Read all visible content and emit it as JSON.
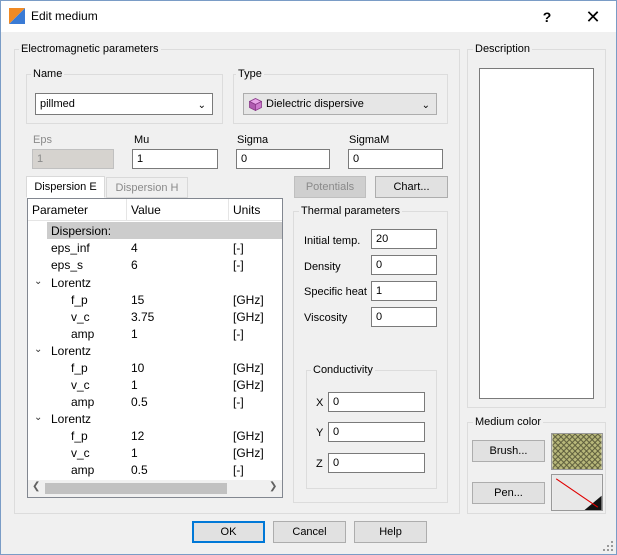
{
  "window": {
    "title": "Edit medium",
    "help_label": "?",
    "close_label": "✕",
    "app_icon": "app-icon"
  },
  "em_group": {
    "label": "Electromagnetic parameters"
  },
  "name": {
    "label": "Name",
    "value": "pillmed"
  },
  "type": {
    "label": "Type",
    "value": "Dielectric dispersive",
    "icon": "cube-icon"
  },
  "fields": {
    "eps": {
      "label": "Eps",
      "value": "1"
    },
    "mu": {
      "label": "Mu",
      "value": "1"
    },
    "sigma": {
      "label": "Sigma",
      "value": "0"
    },
    "sigmam": {
      "label": "SigmaM",
      "value": "0"
    }
  },
  "tabs": {
    "dispersion_e": "Dispersion E",
    "dispersion_h": "Dispersion H"
  },
  "buttons": {
    "potentials": "Potentials",
    "chart": "Chart...",
    "ok": "OK",
    "cancel": "Cancel",
    "help": "Help",
    "brush": "Brush...",
    "pen": "Pen..."
  },
  "table": {
    "headers": [
      "Parameter",
      "Value",
      "Units"
    ],
    "rows": [
      {
        "param": "Dispersion:",
        "value": "",
        "units": ""
      },
      {
        "param": "eps_inf",
        "value": "4",
        "units": "[-]"
      },
      {
        "param": "eps_s",
        "value": "6",
        "units": "[-]"
      },
      {
        "param": "Lorentz",
        "value": "",
        "units": ""
      },
      {
        "param": "f_p",
        "value": "15",
        "units": "[GHz]"
      },
      {
        "param": "v_c",
        "value": "3.75",
        "units": "[GHz]"
      },
      {
        "param": "amp",
        "value": "1",
        "units": "[-]"
      },
      {
        "param": "Lorentz",
        "value": "",
        "units": ""
      },
      {
        "param": "f_p",
        "value": "10",
        "units": "[GHz]"
      },
      {
        "param": "v_c",
        "value": "1",
        "units": "[GHz]"
      },
      {
        "param": "amp",
        "value": "0.5",
        "units": "[-]"
      },
      {
        "param": "Lorentz",
        "value": "",
        "units": ""
      },
      {
        "param": "f_p",
        "value": "12",
        "units": "[GHz]"
      },
      {
        "param": "v_c",
        "value": "1",
        "units": "[GHz]"
      },
      {
        "param": "amp",
        "value": "0.5",
        "units": "[-]"
      }
    ]
  },
  "thermal": {
    "label": "Thermal parameters",
    "initial_temp": {
      "label": "Initial temp.",
      "value": "20"
    },
    "density": {
      "label": "Density",
      "value": "0"
    },
    "specific_heat": {
      "label": "Specific heat",
      "value": "1"
    },
    "viscosity": {
      "label": "Viscosity",
      "value": "0"
    }
  },
  "conductivity": {
    "label": "Conductivity",
    "x": {
      "label": "X",
      "value": "0"
    },
    "y": {
      "label": "Y",
      "value": "0"
    },
    "z": {
      "label": "Z",
      "value": "0"
    }
  },
  "description": {
    "label": "Description",
    "value": ""
  },
  "medium_color": {
    "label": "Medium color",
    "brush_color": "#b8b87a",
    "pen_color": "#e00000"
  }
}
